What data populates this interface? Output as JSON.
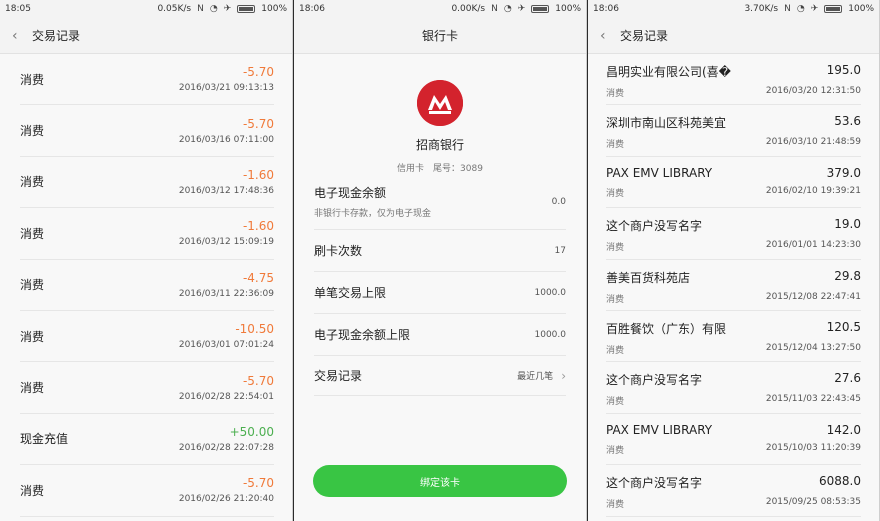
{
  "screen1": {
    "status": {
      "time": "18:05",
      "speed": "0.05K/s",
      "battery": "100%"
    },
    "title": "交易记录",
    "transactions": [
      {
        "type": "消费",
        "amount": "-5.70",
        "time": "2016/03/21 09:13:13",
        "positive": false
      },
      {
        "type": "消费",
        "amount": "-5.70",
        "time": "2016/03/16 07:11:00",
        "positive": false
      },
      {
        "type": "消费",
        "amount": "-1.60",
        "time": "2016/03/12 17:48:36",
        "positive": false
      },
      {
        "type": "消费",
        "amount": "-1.60",
        "time": "2016/03/12 15:09:19",
        "positive": false
      },
      {
        "type": "消费",
        "amount": "-4.75",
        "time": "2016/03/11 22:36:09",
        "positive": false
      },
      {
        "type": "消费",
        "amount": "-10.50",
        "time": "2016/03/01 07:01:24",
        "positive": false
      },
      {
        "type": "消费",
        "amount": "-5.70",
        "time": "2016/02/28 22:54:01",
        "positive": false
      },
      {
        "type": "现金充值",
        "amount": "+50.00",
        "time": "2016/02/28 22:07:28",
        "positive": true
      },
      {
        "type": "消费",
        "amount": "-5.70",
        "time": "2016/02/26 21:20:40",
        "positive": false
      }
    ]
  },
  "screen2": {
    "status": {
      "time": "18:06",
      "speed": "0.00K/s",
      "battery": "100%"
    },
    "title": "银行卡",
    "bank_name": "招商银行",
    "card_info": "信用卡　尾号：3089",
    "rows": [
      {
        "label": "电子现金余额",
        "sub": "非银行卡存款，仅为电子现金",
        "value": "0.0"
      },
      {
        "label": "刷卡次数",
        "sub": "",
        "value": "17"
      },
      {
        "label": "单笔交易上限",
        "sub": "",
        "value": "1000.0"
      },
      {
        "label": "电子现金余额上限",
        "sub": "",
        "value": "1000.0"
      },
      {
        "label": "交易记录",
        "sub": "",
        "value": "最近几笔"
      }
    ],
    "bind_button": "绑定该卡"
  },
  "screen3": {
    "status": {
      "time": "18:06",
      "speed": "3.70K/s",
      "battery": "100%"
    },
    "title": "交易记录",
    "records": [
      {
        "name": "昌明实业有限公司(喜�",
        "amount": "195.0",
        "type": "消费",
        "time": "2016/03/20 12:31:50"
      },
      {
        "name": "深圳市南山区科苑美宜",
        "amount": "53.6",
        "type": "消费",
        "time": "2016/03/10 21:48:59"
      },
      {
        "name": "PAX EMV LIBRARY",
        "amount": "379.0",
        "type": "消费",
        "time": "2016/02/10 19:39:21"
      },
      {
        "name": "这个商户没写名字",
        "amount": "19.0",
        "type": "消费",
        "time": "2016/01/01 14:23:30"
      },
      {
        "name": "善美百货科苑店",
        "amount": "29.8",
        "type": "消费",
        "time": "2015/12/08 22:47:41"
      },
      {
        "name": "百胜餐饮（广东）有限",
        "amount": "120.5",
        "type": "消费",
        "time": "2015/12/04 13:27:50"
      },
      {
        "name": "这个商户没写名字",
        "amount": "27.6",
        "type": "消费",
        "time": "2015/11/03 22:43:45"
      },
      {
        "name": "PAX EMV LIBRARY",
        "amount": "142.0",
        "type": "消费",
        "time": "2015/10/03 11:20:39"
      },
      {
        "name": "这个商户没写名字",
        "amount": "6088.0",
        "type": "消费",
        "time": "2015/09/25 08:53:35"
      }
    ]
  },
  "icons": {
    "status_nfc": "N",
    "status_wifi": "wifi-icon",
    "status_airplane": "airplane-icon",
    "status_battery": "battery-icon",
    "back": "back-arrow-icon",
    "chevron": "chevron-right-icon"
  },
  "colors": {
    "negative": "#f07a3a",
    "positive": "#4caf50",
    "button": "#39c544",
    "bank_logo": "#d3232d"
  }
}
